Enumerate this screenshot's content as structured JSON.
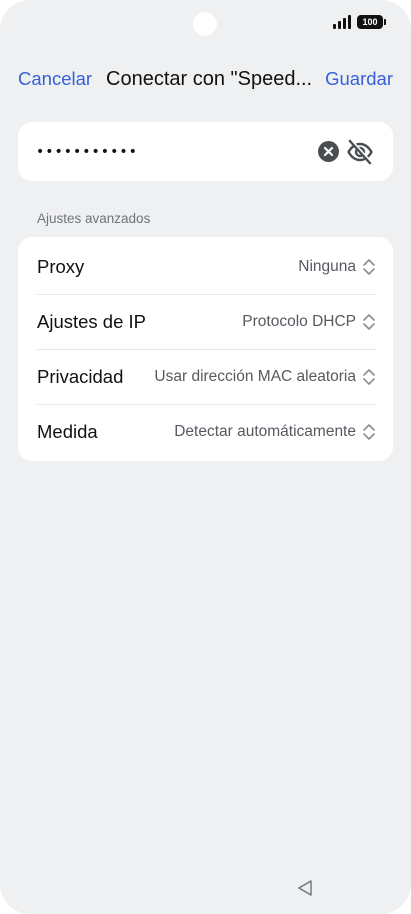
{
  "status_bar": {
    "battery": "100",
    "icons": [
      "signal-icon",
      "battery-icon"
    ]
  },
  "header": {
    "cancel_label": "Cancelar",
    "title": "Conectar con \"Speed...",
    "save_label": "Guardar"
  },
  "password": {
    "value": "•••••••••••",
    "icons": [
      "clear-icon",
      "visibility-off-icon"
    ]
  },
  "advanced": {
    "section_label": "Ajustes avanzados",
    "rows": [
      {
        "label": "Proxy",
        "value": "Ninguna"
      },
      {
        "label": "Ajustes de IP",
        "value": "Protocolo DHCP"
      },
      {
        "label": "Privacidad",
        "value": "Usar dirección MAC aleatoria"
      },
      {
        "label": "Medida",
        "value": "Detectar automáticamente"
      }
    ]
  },
  "colors": {
    "accent": "#3560d9",
    "background": "#eff0f2",
    "card": "#ffffff"
  }
}
